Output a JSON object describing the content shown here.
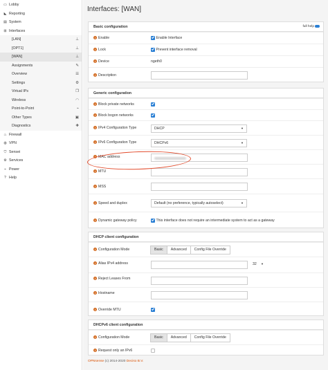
{
  "sidebar": {
    "items": [
      {
        "label": "Lobby",
        "icon": "laptop-icon"
      },
      {
        "label": "Reporting",
        "icon": "area-chart-icon"
      },
      {
        "label": "System",
        "icon": "server-icon"
      },
      {
        "label": "Interfaces",
        "icon": "sitemap-icon"
      },
      {
        "label": "[LAN]",
        "icon": "sitemap-icon"
      },
      {
        "label": "[OPT1]",
        "icon": "sitemap-icon"
      },
      {
        "label": "[WAN]",
        "icon": "sitemap-icon"
      },
      {
        "label": "Assignments",
        "icon": "pencil-icon"
      },
      {
        "label": "Overview",
        "icon": "tasks-icon"
      },
      {
        "label": "Settings",
        "icon": "cogs-icon"
      },
      {
        "label": "Virtual IPs",
        "icon": "clone-icon"
      },
      {
        "label": "Wireless",
        "icon": "wifi-icon"
      },
      {
        "label": "Point-to-Point",
        "icon": "plug-icon"
      },
      {
        "label": "Other Types",
        "icon": "archive-icon"
      },
      {
        "label": "Diagnostics",
        "icon": "medkit-icon"
      },
      {
        "label": "Firewall",
        "icon": "fire-icon"
      },
      {
        "label": "VPN",
        "icon": "globe-icon"
      },
      {
        "label": "Sensei",
        "icon": "shield-icon"
      },
      {
        "label": "Services",
        "icon": "cog-icon"
      },
      {
        "label": "Power",
        "icon": "plug-icon"
      },
      {
        "label": "Help",
        "icon": "question-icon"
      }
    ]
  },
  "page": {
    "title": "Interfaces: [WAN]"
  },
  "basic": {
    "header": "Basic configuration",
    "full_help": "full help",
    "enable_label": "Enable",
    "enable_text": "Enable Interface",
    "lock_label": "Lock",
    "lock_text": "Prevent interface removal",
    "device_label": "Device",
    "device_value": "ngeth0",
    "description_label": "Description"
  },
  "generic": {
    "header": "Generic configuration",
    "block_private": "Block private networks",
    "block_bogon": "Block bogon networks",
    "ipv4_type_label": "IPv4 Configuration Type",
    "ipv4_type_value": "DHCP",
    "ipv6_type_label": "IPv6 Configuration Type",
    "ipv6_type_value": "DHCPv6",
    "mac_label": "MAC address",
    "mtu_label": "MTU",
    "mss_label": "MSS",
    "speed_label": "Speed and duplex",
    "speed_value": "Default (no preference, typically autoselect)",
    "gateway_label": "Dynamic gateway policy",
    "gateway_text": "This interface does not require an intermediate system to act as a gateway"
  },
  "dhcp": {
    "header": "DHCP client configuration",
    "mode_label": "Configuration Mode",
    "modes": [
      "Basic",
      "Advanced",
      "Config File Override"
    ],
    "alias_label": "Alias IPv4 address",
    "alias_prefix": "32",
    "reject_label": "Reject Leases From",
    "hostname_label": "Hostname",
    "override_mtu_label": "Override MTU"
  },
  "dhcp6": {
    "header": "DHCPv6 client configuration",
    "mode_label": "Configuration Mode",
    "modes": [
      "Basic",
      "Advanced",
      "Config File Override"
    ],
    "request_ipv6_label": "Request only an IPv6"
  },
  "footer": {
    "brand": "OPNsense",
    "text": "(c) 2014-2020",
    "company": "Deciso B.V."
  },
  "colors": {
    "accent": "#2a7fd4",
    "info": "#d2691e",
    "annotation": "#e24a2a",
    "brand": "#d94f00"
  }
}
